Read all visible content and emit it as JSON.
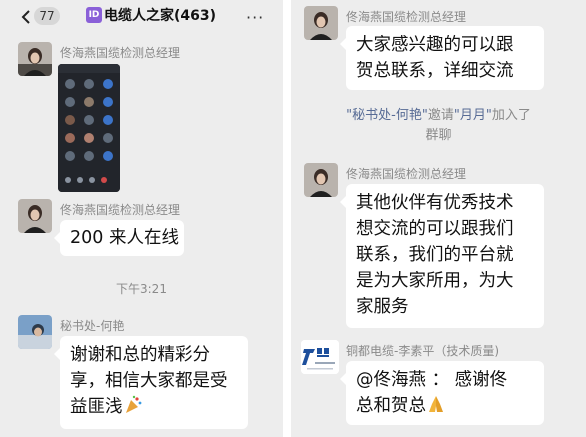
{
  "header": {
    "back_icon": "chevron-left-icon",
    "unread_count": "77",
    "group_icon_label": "ID",
    "group_title": "电缆人之家(463)",
    "more_icon": "more-horizontal-icon"
  },
  "left_messages": [
    {
      "sender": "佟海燕国缆检测总经理",
      "type": "image",
      "image_alt": "screenshot of video call"
    },
    {
      "sender": "佟海燕国缆检测总经理",
      "lines": [
        "200 来人在线"
      ]
    },
    {
      "sender": "秘书处-何艳",
      "lines": [
        "谢谢和总的精彩分",
        "享，相信大家都是受",
        "益匪浅"
      ],
      "trailing_emoji": "party-popper-icon"
    }
  ],
  "left_time": "下午3:21",
  "right_messages": [
    {
      "sender": "佟海燕国缆检测总经理",
      "lines": [
        "大家感兴趣的可以跟",
        "贺总联系，详细交流"
      ]
    },
    {
      "sender": "佟海燕国缆检测总经理",
      "lines": [
        "其他伙伴有优秀技术",
        "想交流的可以跟我们",
        "联系，我们的平台就",
        "是为大家所用，为大",
        "家服务"
      ]
    },
    {
      "sender": "铜都电缆-李素平（技术质量)",
      "lines": [
        "@佟海燕 ： 感谢佟",
        "总和贺总"
      ],
      "trailing_emoji": "folded-hands-icon"
    }
  ],
  "system_message": {
    "inviter": "\"秘书处-何艳\"",
    "verb": "邀请",
    "invitee": "\"月月\"",
    "suffix": "加入了",
    "line2": "群聊"
  },
  "logo_text": "铜都",
  "colors": {
    "chat_bg": "#ededed",
    "bubble": "#ffffff",
    "link": "#576b95",
    "group_icon": "#8a60d8"
  }
}
